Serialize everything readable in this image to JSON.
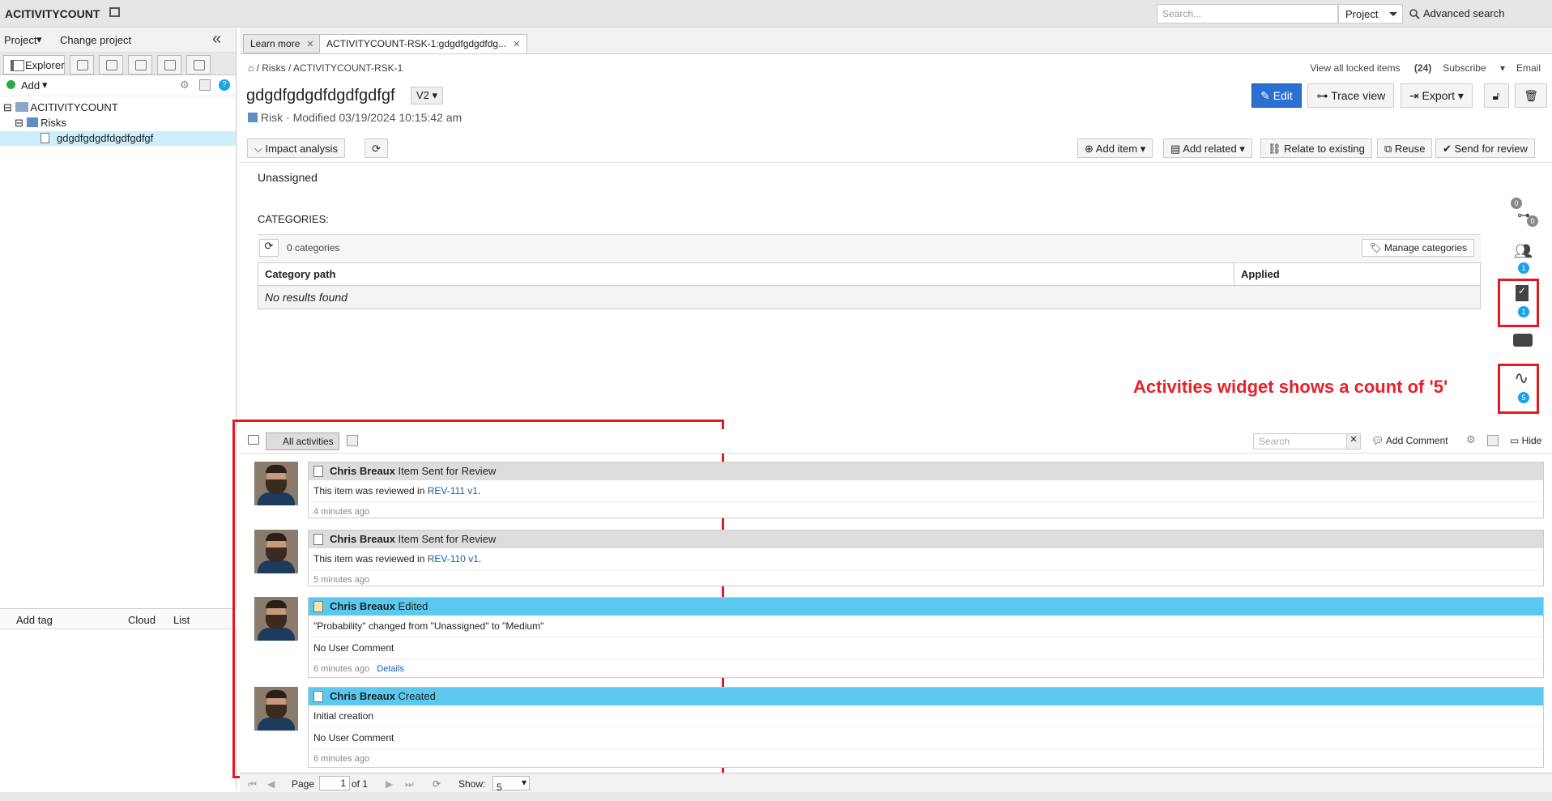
{
  "header": {
    "app_title": "ACITIVITYCOUNT",
    "search_placeholder": "Search...",
    "project_select": "Project",
    "advanced_search": "Advanced search"
  },
  "left": {
    "project_menu": "Project",
    "change_project": "Change project",
    "explorer_tab": "Explorer",
    "add_label": "Add",
    "tree": {
      "root": "ACITIVITYCOUNT",
      "folder": "Risks",
      "item": "gdgdfgdgdfdgdfgdfgf"
    },
    "tagbar": {
      "add_tag": "Add tag",
      "cloud": "Cloud",
      "list": "List"
    }
  },
  "tabs": [
    {
      "label": "Learn more"
    },
    {
      "label": "ACTIVITYCOUNT-RSK-1:gdgdfgdgdfdg..."
    }
  ],
  "breadcrumb": {
    "root": "Risks",
    "current": "ACTIVITYCOUNT-RSK-1"
  },
  "topright": {
    "locked_label": "View all locked items",
    "locked_count": "(24)",
    "subscribe": "Subscribe",
    "email": "Email"
  },
  "item": {
    "title": "gdgdfgdgdfdgdfgdfgf",
    "version": "V2",
    "type": "Risk",
    "modified": "Modified 03/19/2024 10:15:42 am"
  },
  "actions": {
    "edit": "Edit",
    "trace": "Trace view",
    "export": "Export"
  },
  "toolbar": {
    "impact": "Impact analysis",
    "add_item": "Add item",
    "add_related": "Add related",
    "relate": "Relate to existing",
    "reuse": "Reuse",
    "send": "Send for review"
  },
  "content": {
    "unassigned": "Unassigned",
    "categories_title": "CATEGORIES:",
    "count": "0 categories",
    "manage": "Manage categories",
    "col_path": "Category path",
    "col_applied": "Applied",
    "empty": "No results found"
  },
  "rail": {
    "relations_top": "0",
    "relations_bottom": "0",
    "collab": "1",
    "reviews": "1",
    "activities": "5"
  },
  "annotation": "Activities widget shows a count of '5'",
  "activity_bar": {
    "all": "All activities",
    "search_placeholder": "Search",
    "add_comment": "Add Comment",
    "hide": "Hide"
  },
  "activities": [
    {
      "user": "Chris Breaux",
      "action": "Item Sent for Review",
      "line1_pre": "This item was reviewed in ",
      "link": "REV-111 v1",
      "line1_post": ".",
      "time": "4 minutes ago"
    },
    {
      "user": "Chris Breaux",
      "action": "Item Sent for Review",
      "line1_pre": "This item was reviewed in ",
      "link": "REV-110 v1",
      "line1_post": ".",
      "time": "5 minutes ago"
    },
    {
      "user": "Chris Breaux",
      "action": "Edited",
      "line1": "\"Probability\" changed from \"Unassigned\" to \"Medium\"",
      "line2": "No User Comment",
      "time": "6 minutes ago",
      "details": "Details"
    },
    {
      "user": "Chris Breaux",
      "action": "Created",
      "line1": "Initial creation",
      "line2": "No User Comment",
      "time": "6 minutes ago"
    }
  ],
  "pager": {
    "page_label": "Page",
    "page": "1",
    "of": "of 1",
    "show_label": "Show:",
    "show": "5"
  },
  "colors": {
    "accent": "#2a6fd1",
    "activity_blue": "#5bc8ef",
    "badge": "#1aa3e8",
    "annotation_red": "#e01b24"
  }
}
